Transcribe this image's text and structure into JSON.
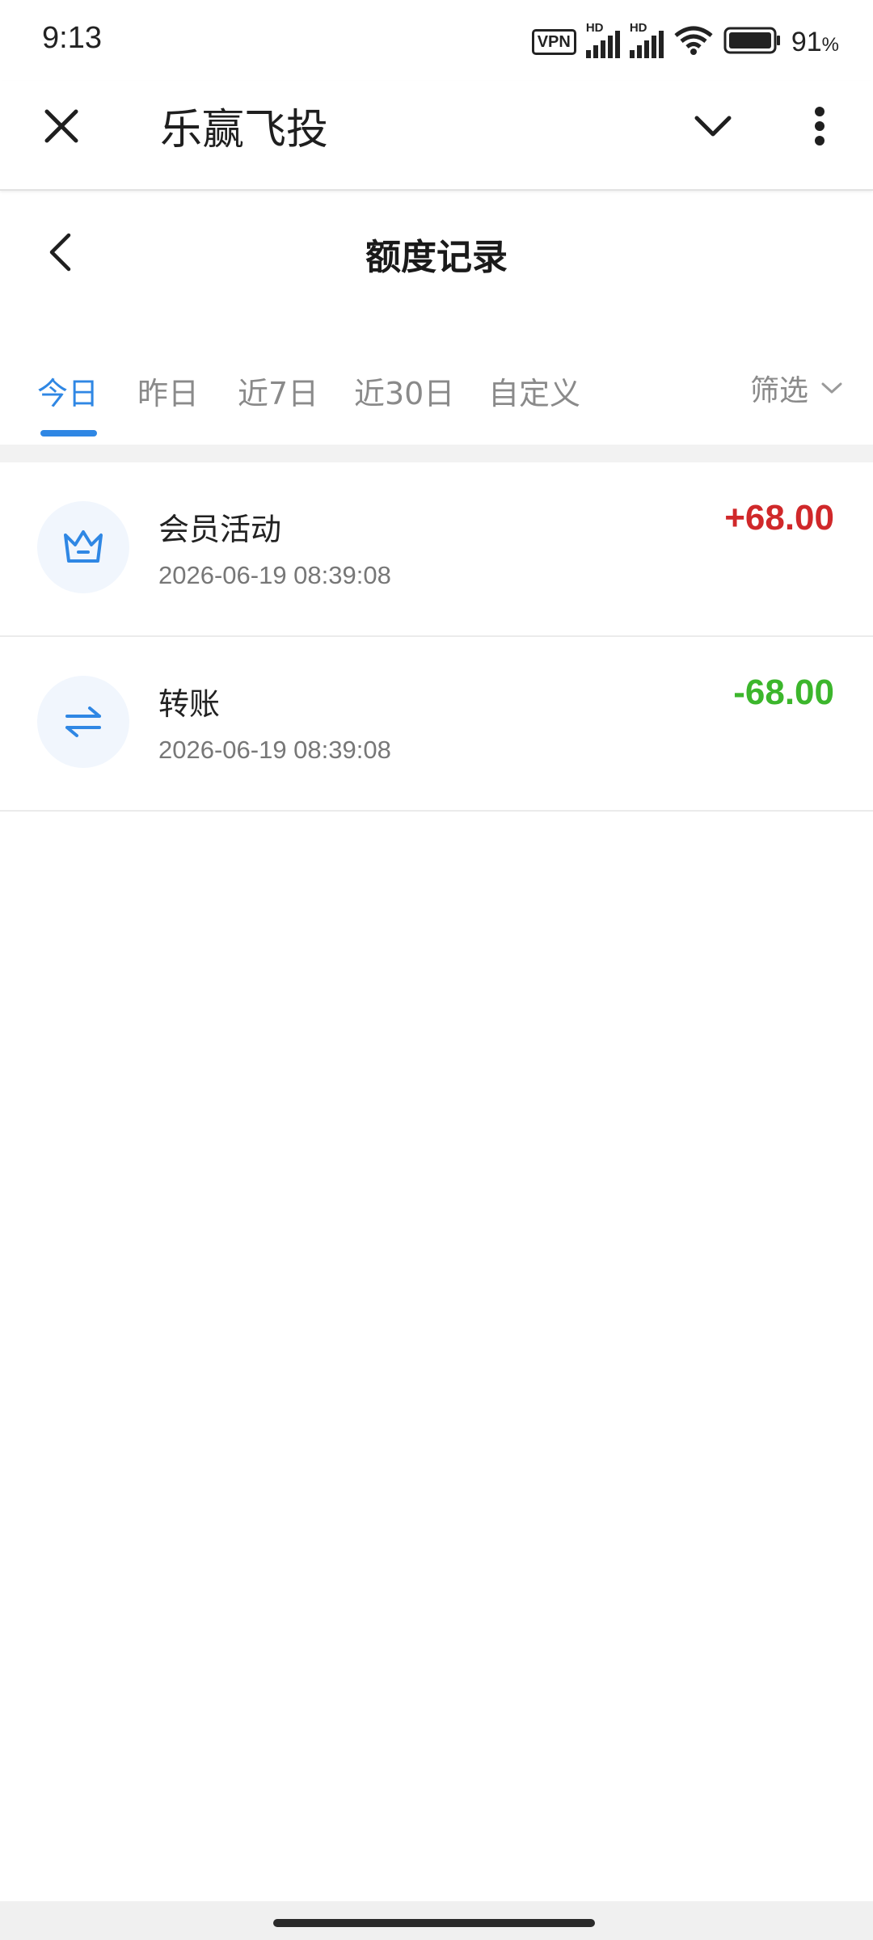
{
  "status_bar": {
    "time": "9:13",
    "vpn": "VPN",
    "signal_1": "HD",
    "signal_2": "HD",
    "battery_percent": "91",
    "battery_unit": "%"
  },
  "app_header": {
    "title": "乐赢飞投",
    "icons": [
      "close-icon",
      "chevron-down-icon",
      "more-vertical-icon"
    ]
  },
  "page": {
    "title": "额度记录"
  },
  "tabs": {
    "items": [
      {
        "label": "今日",
        "active": true
      },
      {
        "label": "昨日",
        "active": false
      },
      {
        "label": "近7日",
        "active": false
      },
      {
        "label": "近30日",
        "active": false
      },
      {
        "label": "自定义",
        "active": false
      }
    ],
    "filter_label": "筛选"
  },
  "records": [
    {
      "icon": "crown-icon",
      "title": "会员活动",
      "time": "2026-06-19 08:39:08",
      "amount": "+68.00",
      "type": "positive"
    },
    {
      "icon": "transfer-icon",
      "title": "转账",
      "time": "2026-06-19 08:39:08",
      "amount": "-68.00",
      "type": "negative"
    }
  ],
  "colors": {
    "accent": "#2f87e4",
    "positive_amount": "#d0282a",
    "negative_amount": "#3cb62c",
    "icon_bg": "#f1f6fd"
  }
}
